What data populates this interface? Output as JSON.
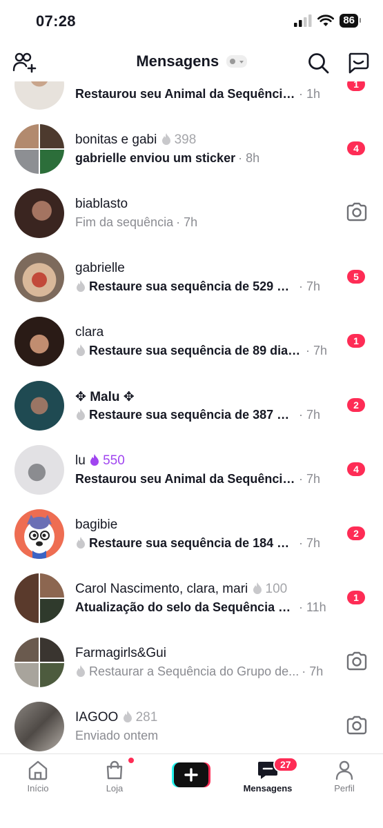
{
  "status_bar": {
    "time": "07:28",
    "battery": "86"
  },
  "header": {
    "title": "Mensagens"
  },
  "conversations": [
    {
      "name": "",
      "subtitle": "Restaurou seu Animal da Sequência...",
      "time": "· 1h",
      "badge": "1",
      "style": "bold"
    },
    {
      "name": "bonitas e gabi",
      "streak": "398",
      "subtitle": "gabrielle enviou um sticker",
      "time": "· 8h",
      "badge": "4",
      "style": "bold"
    },
    {
      "name": "biablasto",
      "subtitle": "Fim da sequência",
      "time": "· 7h",
      "style": "gray",
      "camera": true
    },
    {
      "name": "gabrielle",
      "subtitle": "Restaure sua sequência de 529 di...",
      "time": "· 7h",
      "badge": "5",
      "style": "bold"
    },
    {
      "name": "clara",
      "subtitle": "Restaure sua sequência de 89 dia(s)",
      "time": "· 7h",
      "badge": "1",
      "style": "bold"
    },
    {
      "name": "✥ Malu ✥",
      "subtitle": "Restaure sua sequência de 387 di...",
      "time": "· 7h",
      "badge": "2",
      "style": "bold"
    },
    {
      "name": "lu",
      "streak": "550",
      "subtitle": "Restaurou seu Animal da Sequência...",
      "time": "· 7h",
      "badge": "4",
      "style": "bold"
    },
    {
      "name": "bagibie",
      "subtitle": "Restaure sua sequência de 184 di...",
      "time": "· 7h",
      "badge": "2",
      "style": "bold"
    },
    {
      "name": "Carol Nascimento, clara, mari",
      "streak": "100",
      "subtitle": "Atualização do selo da Sequência d...",
      "time": "· 11h",
      "badge": "1",
      "style": "bold"
    },
    {
      "name": "Farmagirls&Gui",
      "subtitle": "Restaurar a Sequência do Grupo de...",
      "time": "· 7h",
      "style": "gray",
      "camera": true
    },
    {
      "name": "IAGOO",
      "streak": "281",
      "subtitle": "Enviado ontem",
      "time": "",
      "style": "gray",
      "camera": true
    }
  ],
  "tabbar": {
    "home": "Início",
    "shop": "Loja",
    "messages": "Mensagens",
    "messages_count": "27",
    "profile": "Perfil"
  },
  "colors": {
    "accent": "#fe2c55",
    "streak_purple": "#a045f0",
    "muted": "#8a8b91"
  }
}
